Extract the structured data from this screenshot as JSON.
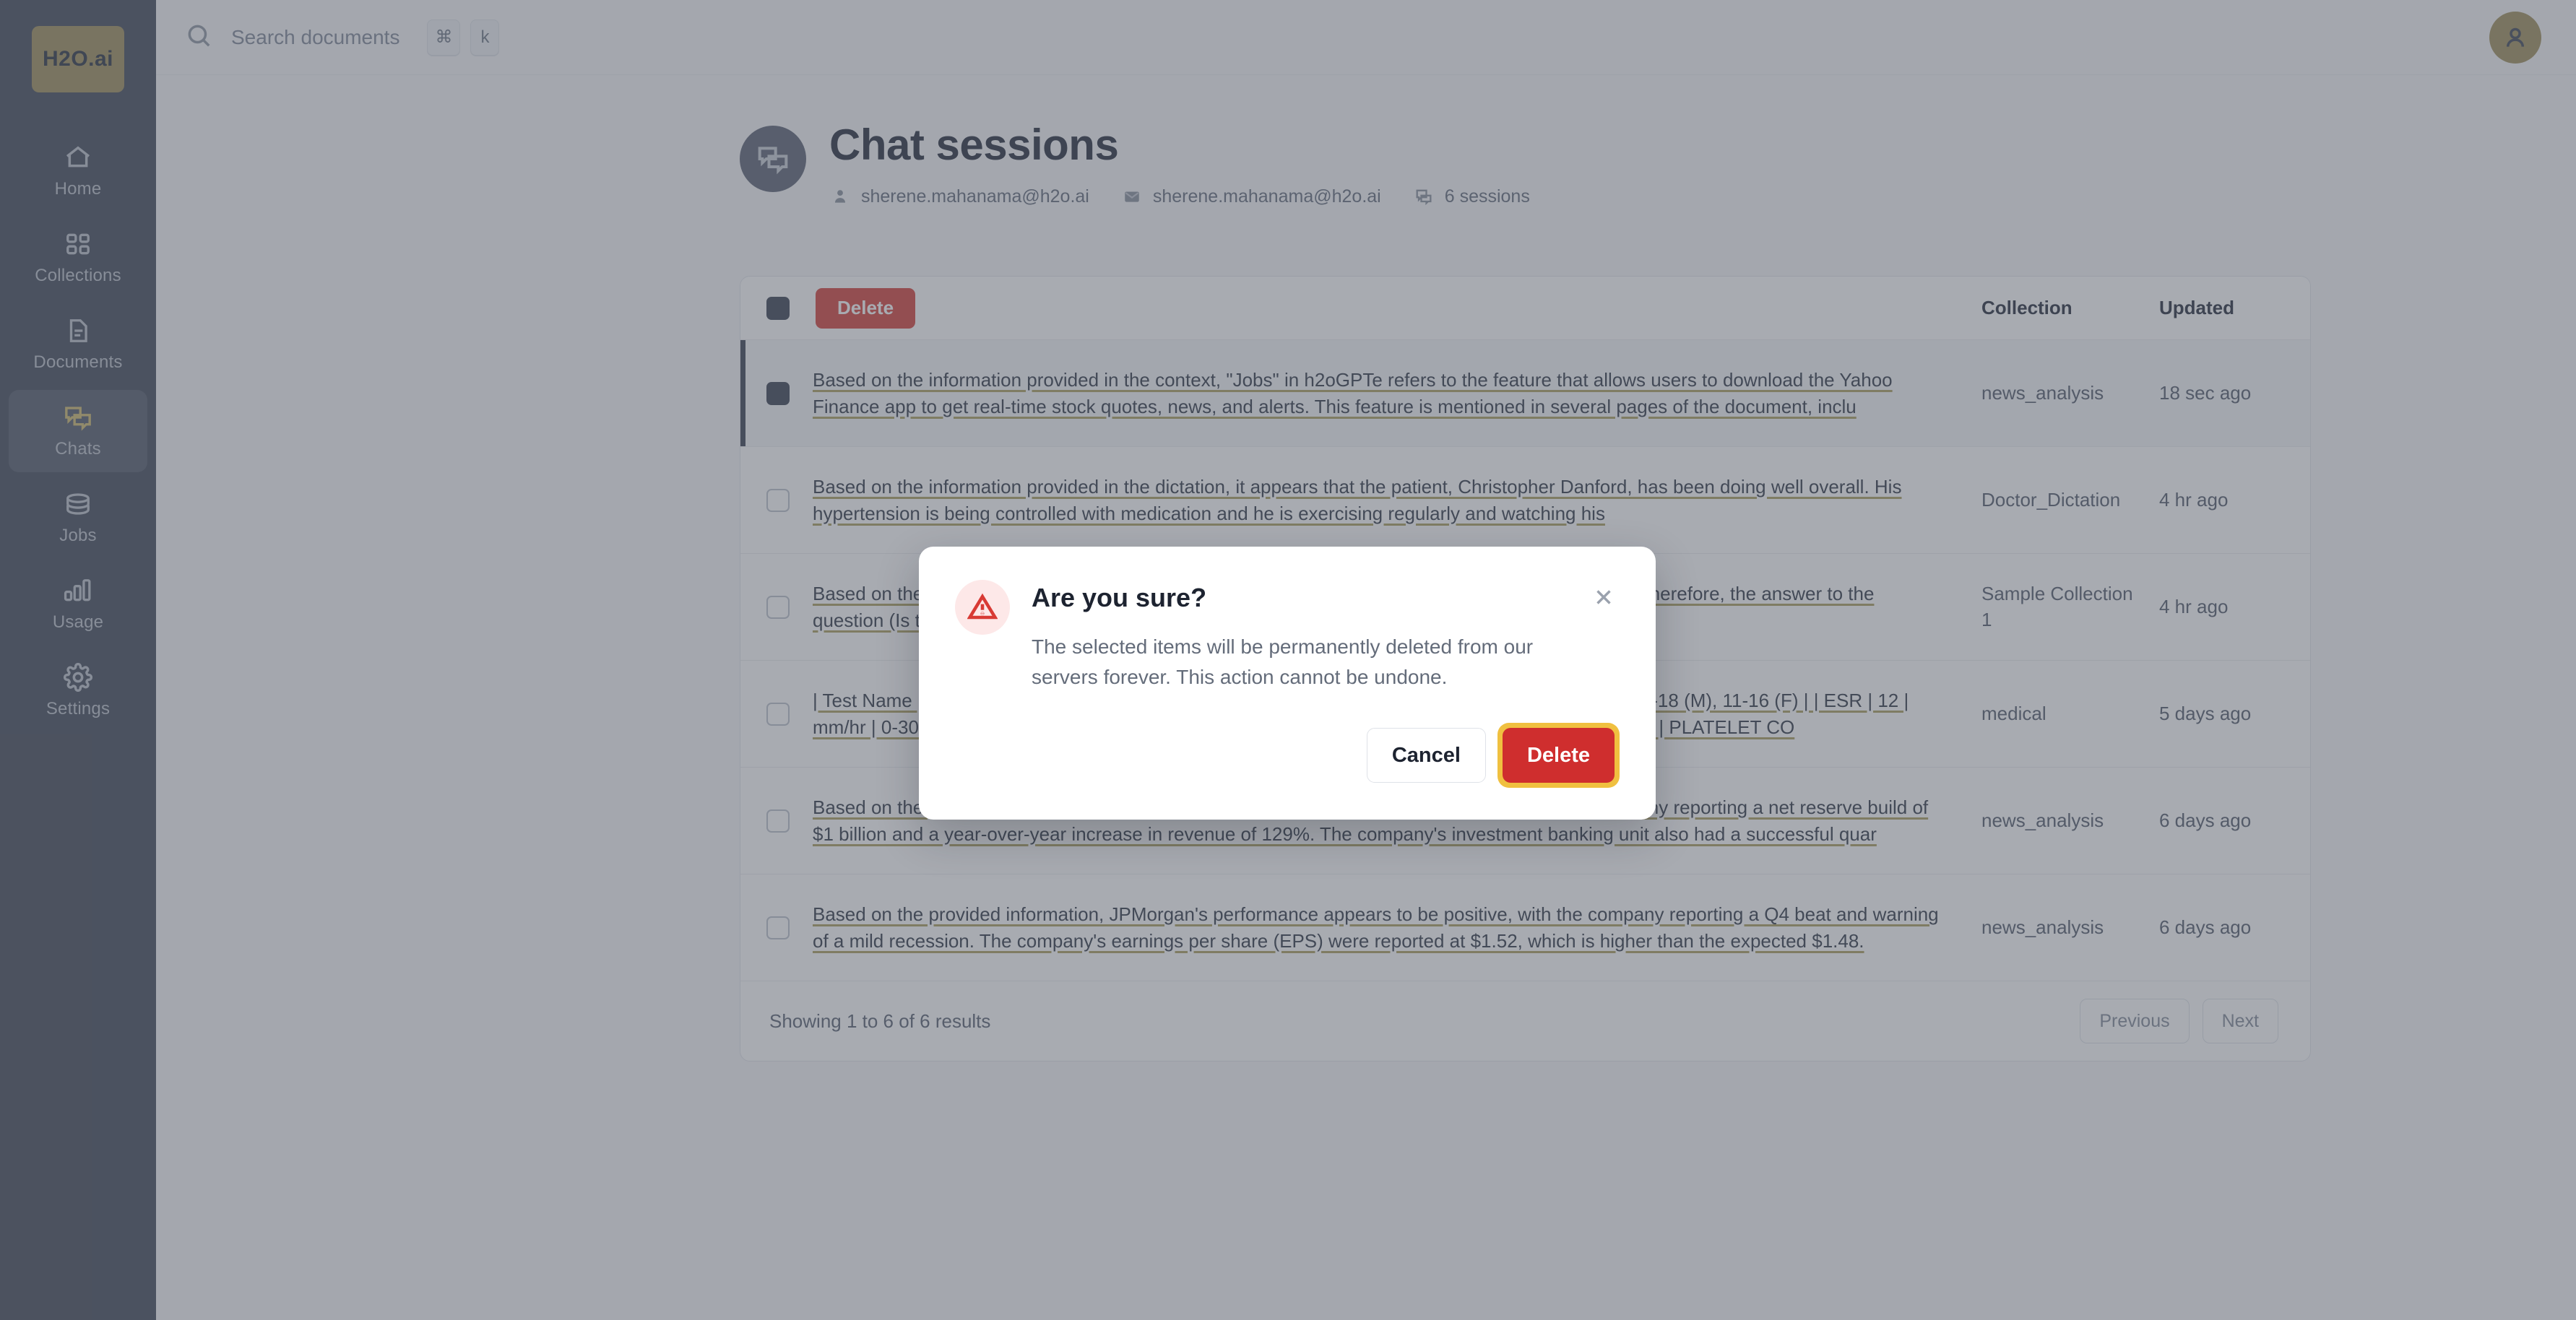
{
  "sidebar": {
    "brand": "H2O.ai",
    "items": [
      {
        "label": "Home",
        "icon": "home-icon",
        "active": false
      },
      {
        "label": "Collections",
        "icon": "collections-icon",
        "active": false
      },
      {
        "label": "Documents",
        "icon": "documents-icon",
        "active": false
      },
      {
        "label": "Chats",
        "icon": "chats-icon",
        "active": true
      },
      {
        "label": "Jobs",
        "icon": "jobs-icon",
        "active": false
      },
      {
        "label": "Usage",
        "icon": "usage-icon",
        "active": false
      },
      {
        "label": "Settings",
        "icon": "settings-icon",
        "active": false
      }
    ]
  },
  "topbar": {
    "search_placeholder": "Search documents",
    "shortcut_keys": [
      "⌘",
      "k"
    ],
    "search_icon": "search-icon",
    "avatar_icon": "user-icon"
  },
  "page": {
    "title": "Chat sessions",
    "header_icon": "chat-bubbles-icon",
    "meta": [
      {
        "icon": "user-icon",
        "text": "sherene.mahanama@h2o.ai"
      },
      {
        "icon": "envelope-icon",
        "text": "sherene.mahanama@h2o.ai"
      },
      {
        "icon": "chat-icon",
        "text": "6 sessions"
      }
    ]
  },
  "table": {
    "delete_label": "Delete",
    "columns": {
      "collection": "Collection",
      "updated": "Updated"
    },
    "rows": [
      {
        "text": "Based on the information provided in the context, \"Jobs\" in h2oGPTe refers to the feature that allows users to download the Yahoo Finance app to get real-time stock quotes, news, and alerts. This feature is mentioned in several pages of the document, inclu",
        "collection": "news_analysis",
        "updated": "18 sec ago",
        "selected": true
      },
      {
        "text": "Based on the information provided in the dictation, it appears that the patient, Christopher Danford, has been doing well overall. His hypertension is being controlled with medication and he is exercising regularly and watching his",
        "collection": "Doctor_Dictation",
        "updated": "4 hr ago",
        "selected": false
      },
      {
        "text": "Based on the information provided in the context, the document does not contain any Chinese text. Therefore, the answer to the question (Is this Chinese?) is no.",
        "collection": "Sample Collection 1",
        "updated": "4 hr ago",
        "selected": false
      },
      {
        "text": "| Test Name | Results | Units | Bio Ref Interval | | --- | --- | --- | --- | | HAEMOGLOBIN | 11.3 | gm/dl | 13-18 (M), 11-16 (F) | | ESR | 12 | mm/hr | 0-30 (M), 0-30 (F) | | WBCCOUNT | 10,500 | cells/cumm | 4000-11,000 (M), 4000-11,000 (F) | | PLATELET CO",
        "collection": "medical",
        "updated": "5 days ago",
        "selected": false
      },
      {
        "text": "Based on the provided information, JPMorgan's performance in Q4 2022 was strong, with the company reporting a net reserve build of $1 billion and a year-over-year increase in revenue of 129%. The company's investment banking unit also had a successful quar",
        "collection": "news_analysis",
        "updated": "6 days ago",
        "selected": false
      },
      {
        "text": "Based on the provided information, JPMorgan's performance appears to be positive, with the company reporting a Q4 beat and warning of a mild recession. The company's earnings per share (EPS) were reported at $1.52, which is higher than the expected $1.48.",
        "collection": "news_analysis",
        "updated": "6 days ago",
        "selected": false
      }
    ],
    "footer": {
      "results_text": "Showing 1 to 6 of 6 results",
      "previous": "Previous",
      "next": "Next"
    }
  },
  "modal": {
    "title": "Are you sure?",
    "message": "The selected items will be permanently deleted from our servers forever. This action cannot be undone.",
    "cancel_label": "Cancel",
    "confirm_label": "Delete",
    "warning_icon": "warning-triangle-icon",
    "close_icon": "close-icon"
  },
  "colors": {
    "sidebar_bg": "#545b69",
    "brand_gold": "#a99a6b",
    "accent_gold": "#d4c27e",
    "danger_red": "#cf2e2e",
    "focus_ring": "#f0c040"
  }
}
